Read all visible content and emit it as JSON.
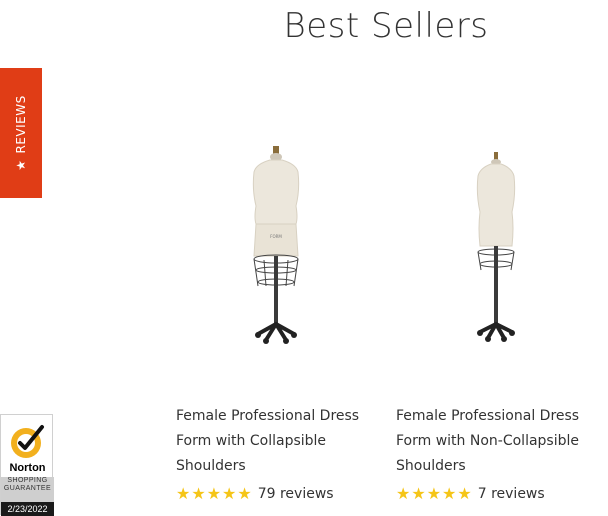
{
  "section": {
    "title": "Best Sellers"
  },
  "reviews_tab": {
    "icon": "star-icon",
    "label": "REVIEWS",
    "color": "#e03d16"
  },
  "products": [
    {
      "name_lines": [
        "Female Professional Dress",
        "Form with Collapsible",
        "Shoulders"
      ],
      "rating": 5,
      "review_count": "79 reviews",
      "image": "dress-form-collapsible-image"
    },
    {
      "name_lines": [
        "Female Professional Dress",
        "Form with Non-Collapsible",
        "Shoulders"
      ],
      "rating": 5,
      "review_count": "7 reviews",
      "image": "dress-form-non-collapsible-image"
    }
  ],
  "norton_badge": {
    "brand": "Norton",
    "line1": "SHOPPING",
    "line2": "GUARANTEE",
    "date": "2/23/2022",
    "accent": "#f2b01e"
  },
  "colors": {
    "star": "#f5c518",
    "text": "#333333"
  }
}
